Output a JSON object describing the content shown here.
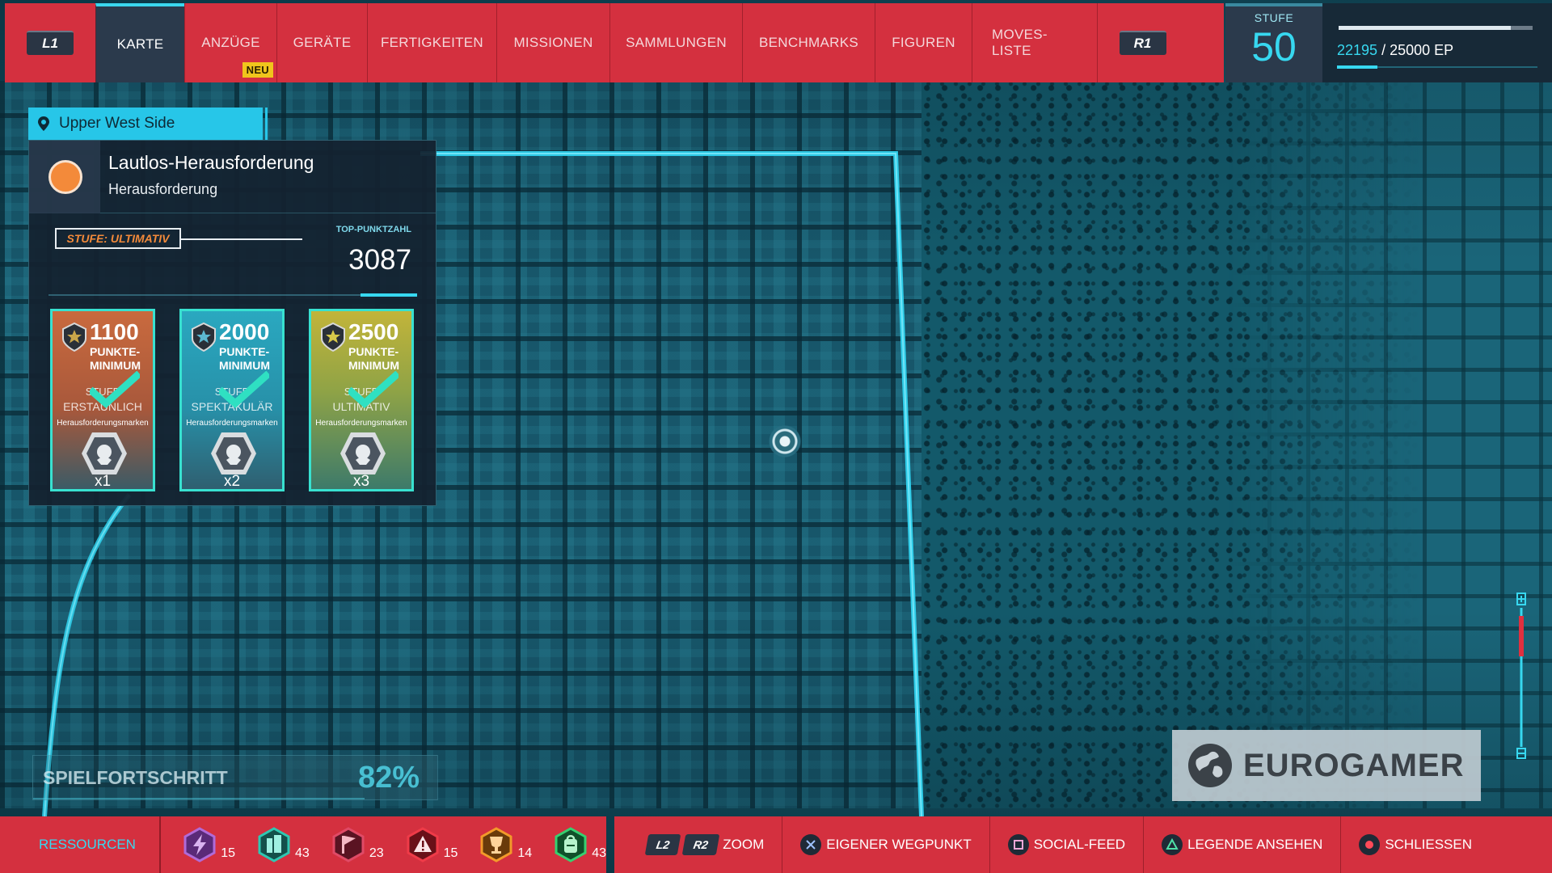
{
  "top_nav": {
    "left_button": "L1",
    "right_button": "R1",
    "tabs": [
      {
        "label": "KARTE",
        "active": true
      },
      {
        "label": "ANZÜGE",
        "badge": "NEU"
      },
      {
        "label": "GERÄTE"
      },
      {
        "label": "FERTIGKEITEN"
      },
      {
        "label": "MISSIONEN"
      },
      {
        "label": "SAMMLUNGEN"
      },
      {
        "label": "BENCHMARKS"
      },
      {
        "label": "FIGUREN"
      },
      {
        "label": "MOVES-LISTE"
      }
    ]
  },
  "level": {
    "label": "STUFE",
    "value": "50"
  },
  "xp": {
    "current": "22195",
    "separator": " / ",
    "max": "25000 EP",
    "fraction": 0.888
  },
  "challenge": {
    "location": "Upper West Side",
    "title": "Lautlos-Herausforderung",
    "subtitle": "Herausforderung",
    "tier_label": "STUFE: ULTIMATIV",
    "top_score_label": "TOP-PUNKTZAHL",
    "top_score": "3087",
    "cards": [
      {
        "points": "1100",
        "min_line1": "PUNKTE-",
        "min_line2": "MINIMUM",
        "stufe": "STUFE",
        "level": "ERSTAUNLICH",
        "marks": "Herausforderungsmarken",
        "multiplier": "x1"
      },
      {
        "points": "2000",
        "min_line1": "PUNKTE-",
        "min_line2": "MINIMUM",
        "stufe": "STUFE",
        "level": "SPEKTAKULÄR",
        "marks": "Herausforderungsmarken",
        "multiplier": "x2"
      },
      {
        "points": "2500",
        "min_line1": "PUNKTE-",
        "min_line2": "MINIMUM",
        "stufe": "STUFE",
        "level": "ULTIMATIV",
        "marks": "Herausforderungsmarken",
        "multiplier": "x3"
      }
    ]
  },
  "progress": {
    "label": "SPIELFORTSCHRITT",
    "value": "82%",
    "fraction": 0.82
  },
  "watermark": {
    "text": "EUROGAMER"
  },
  "resources": {
    "label": "RESSOURCEN",
    "items": [
      {
        "icon": "purple-lightning-hex-icon",
        "color": "#8b3fb5",
        "count": "15"
      },
      {
        "icon": "teal-building-hex-icon",
        "color": "#1fa596",
        "count": "43"
      },
      {
        "icon": "red-flag-hex-icon",
        "color": "#b8203a",
        "count": "23"
      },
      {
        "icon": "red-warning-hex-icon",
        "color": "#c4202e",
        "count": "15"
      },
      {
        "icon": "orange-trophy-hex-icon",
        "color": "#e07a1a",
        "count": "14"
      },
      {
        "icon": "green-backpack-hex-icon",
        "color": "#26b15a",
        "count": "43"
      }
    ]
  },
  "controls": {
    "zoom_l2": "L2",
    "zoom_r2": "R2",
    "zoom": "ZOOM",
    "waypoint": "EIGENER WEGPUNKT",
    "social": "SOCIAL-FEED",
    "legend": "LEGENDE ANSEHEN",
    "close": "SCHLIESSEN"
  },
  "colors": {
    "accent": "#37d8f0",
    "bar_red": "#d4303f",
    "panel": "#142230"
  }
}
